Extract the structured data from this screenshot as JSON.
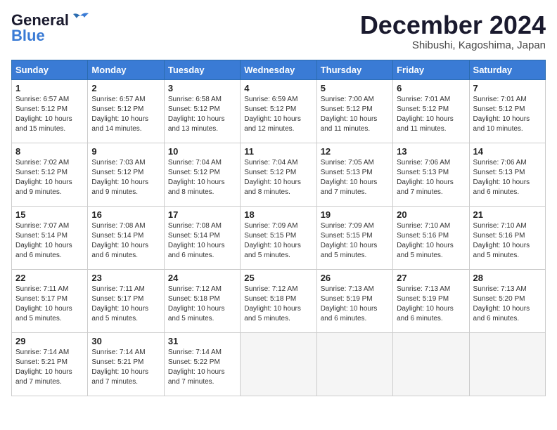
{
  "logo": {
    "general": "General",
    "blue": "Blue"
  },
  "title": "December 2024",
  "location": "Shibushi, Kagoshima, Japan",
  "weekdays": [
    "Sunday",
    "Monday",
    "Tuesday",
    "Wednesday",
    "Thursday",
    "Friday",
    "Saturday"
  ],
  "weeks": [
    [
      {
        "day": "1",
        "info": "Sunrise: 6:57 AM\nSunset: 5:12 PM\nDaylight: 10 hours\nand 15 minutes."
      },
      {
        "day": "2",
        "info": "Sunrise: 6:57 AM\nSunset: 5:12 PM\nDaylight: 10 hours\nand 14 minutes."
      },
      {
        "day": "3",
        "info": "Sunrise: 6:58 AM\nSunset: 5:12 PM\nDaylight: 10 hours\nand 13 minutes."
      },
      {
        "day": "4",
        "info": "Sunrise: 6:59 AM\nSunset: 5:12 PM\nDaylight: 10 hours\nand 12 minutes."
      },
      {
        "day": "5",
        "info": "Sunrise: 7:00 AM\nSunset: 5:12 PM\nDaylight: 10 hours\nand 11 minutes."
      },
      {
        "day": "6",
        "info": "Sunrise: 7:01 AM\nSunset: 5:12 PM\nDaylight: 10 hours\nand 11 minutes."
      },
      {
        "day": "7",
        "info": "Sunrise: 7:01 AM\nSunset: 5:12 PM\nDaylight: 10 hours\nand 10 minutes."
      }
    ],
    [
      {
        "day": "8",
        "info": "Sunrise: 7:02 AM\nSunset: 5:12 PM\nDaylight: 10 hours\nand 9 minutes."
      },
      {
        "day": "9",
        "info": "Sunrise: 7:03 AM\nSunset: 5:12 PM\nDaylight: 10 hours\nand 9 minutes."
      },
      {
        "day": "10",
        "info": "Sunrise: 7:04 AM\nSunset: 5:12 PM\nDaylight: 10 hours\nand 8 minutes."
      },
      {
        "day": "11",
        "info": "Sunrise: 7:04 AM\nSunset: 5:12 PM\nDaylight: 10 hours\nand 8 minutes."
      },
      {
        "day": "12",
        "info": "Sunrise: 7:05 AM\nSunset: 5:13 PM\nDaylight: 10 hours\nand 7 minutes."
      },
      {
        "day": "13",
        "info": "Sunrise: 7:06 AM\nSunset: 5:13 PM\nDaylight: 10 hours\nand 7 minutes."
      },
      {
        "day": "14",
        "info": "Sunrise: 7:06 AM\nSunset: 5:13 PM\nDaylight: 10 hours\nand 6 minutes."
      }
    ],
    [
      {
        "day": "15",
        "info": "Sunrise: 7:07 AM\nSunset: 5:14 PM\nDaylight: 10 hours\nand 6 minutes."
      },
      {
        "day": "16",
        "info": "Sunrise: 7:08 AM\nSunset: 5:14 PM\nDaylight: 10 hours\nand 6 minutes."
      },
      {
        "day": "17",
        "info": "Sunrise: 7:08 AM\nSunset: 5:14 PM\nDaylight: 10 hours\nand 6 minutes."
      },
      {
        "day": "18",
        "info": "Sunrise: 7:09 AM\nSunset: 5:15 PM\nDaylight: 10 hours\nand 5 minutes."
      },
      {
        "day": "19",
        "info": "Sunrise: 7:09 AM\nSunset: 5:15 PM\nDaylight: 10 hours\nand 5 minutes."
      },
      {
        "day": "20",
        "info": "Sunrise: 7:10 AM\nSunset: 5:16 PM\nDaylight: 10 hours\nand 5 minutes."
      },
      {
        "day": "21",
        "info": "Sunrise: 7:10 AM\nSunset: 5:16 PM\nDaylight: 10 hours\nand 5 minutes."
      }
    ],
    [
      {
        "day": "22",
        "info": "Sunrise: 7:11 AM\nSunset: 5:17 PM\nDaylight: 10 hours\nand 5 minutes."
      },
      {
        "day": "23",
        "info": "Sunrise: 7:11 AM\nSunset: 5:17 PM\nDaylight: 10 hours\nand 5 minutes."
      },
      {
        "day": "24",
        "info": "Sunrise: 7:12 AM\nSunset: 5:18 PM\nDaylight: 10 hours\nand 5 minutes."
      },
      {
        "day": "25",
        "info": "Sunrise: 7:12 AM\nSunset: 5:18 PM\nDaylight: 10 hours\nand 5 minutes."
      },
      {
        "day": "26",
        "info": "Sunrise: 7:13 AM\nSunset: 5:19 PM\nDaylight: 10 hours\nand 6 minutes."
      },
      {
        "day": "27",
        "info": "Sunrise: 7:13 AM\nSunset: 5:19 PM\nDaylight: 10 hours\nand 6 minutes."
      },
      {
        "day": "28",
        "info": "Sunrise: 7:13 AM\nSunset: 5:20 PM\nDaylight: 10 hours\nand 6 minutes."
      }
    ],
    [
      {
        "day": "29",
        "info": "Sunrise: 7:14 AM\nSunset: 5:21 PM\nDaylight: 10 hours\nand 7 minutes."
      },
      {
        "day": "30",
        "info": "Sunrise: 7:14 AM\nSunset: 5:21 PM\nDaylight: 10 hours\nand 7 minutes."
      },
      {
        "day": "31",
        "info": "Sunrise: 7:14 AM\nSunset: 5:22 PM\nDaylight: 10 hours\nand 7 minutes."
      },
      null,
      null,
      null,
      null
    ]
  ]
}
